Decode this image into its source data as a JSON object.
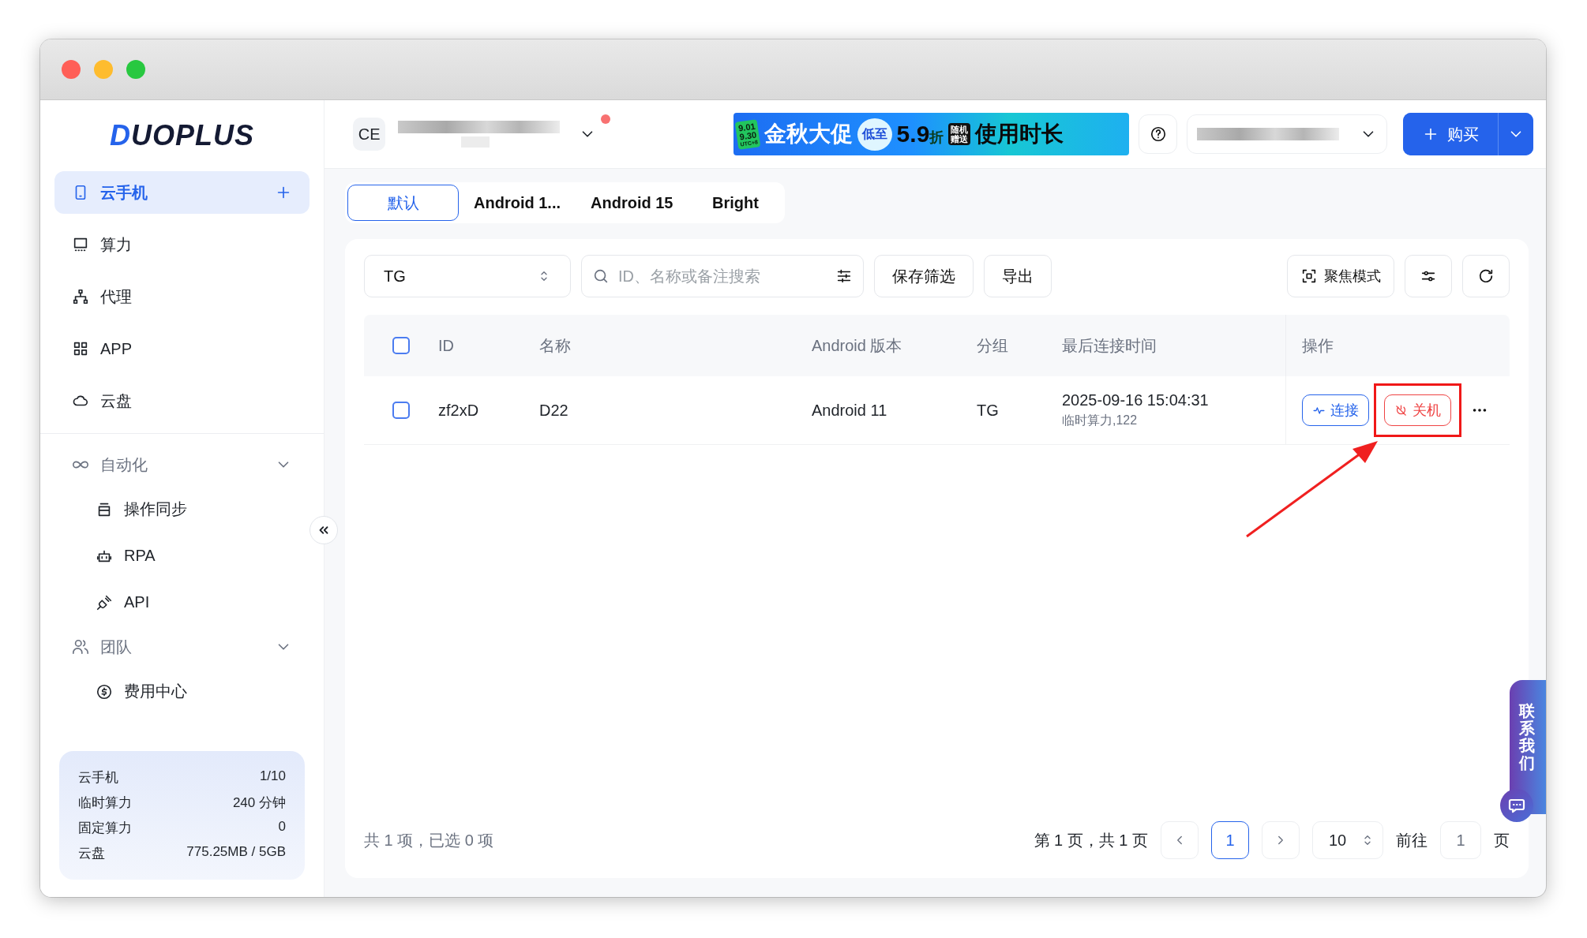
{
  "window": {
    "traffic_lights": [
      {
        "color": "#ff5f57"
      },
      {
        "color": "#febc2e"
      },
      {
        "color": "#28c840"
      }
    ]
  },
  "logo": {
    "mark": "D",
    "text": "UOPLUS"
  },
  "sidebar": {
    "nav": [
      {
        "label": "云手机",
        "selected": true
      },
      {
        "label": "算力",
        "selected": false
      },
      {
        "label": "代理",
        "selected": false
      },
      {
        "label": "APP",
        "selected": false
      },
      {
        "label": "云盘",
        "selected": false
      }
    ],
    "groups": [
      {
        "label": "自动化",
        "expanded": true,
        "children": [
          {
            "label": "操作同步",
            "selected": false
          },
          {
            "label": "RPA",
            "selected": false
          },
          {
            "label": "API",
            "selected": false
          }
        ]
      },
      {
        "label": "团队",
        "expanded": true,
        "children": [
          {
            "label": "费用中心",
            "selected": false
          }
        ]
      }
    ],
    "usage": [
      {
        "label": "云手机",
        "value": "1/10"
      },
      {
        "label": "临时算力",
        "value": "240 分钟"
      },
      {
        "label": "固定算力",
        "value": "0"
      },
      {
        "label": "云盘",
        "value": "775.25MB / 5GB"
      }
    ]
  },
  "top_bar": {
    "workspace": "CE",
    "notification": true,
    "promo_banner": {
      "date_badge": [
        "9.01",
        "9.30",
        "UTC+8"
      ],
      "headline": "金秋大促",
      "discount_prefix": "低至",
      "discount": "5.9",
      "discount_unit": "折",
      "gift_tag": [
        "随机",
        "赠送"
      ],
      "tagline": "使用时长"
    },
    "buy_button": "购买"
  },
  "tabs": [
    {
      "label": "默认",
      "selected": true
    },
    {
      "label": "Android 1...",
      "selected": false
    },
    {
      "label": "Android 15",
      "selected": false
    },
    {
      "label": "Bright",
      "selected": false
    }
  ],
  "toolbar": {
    "group_select": "TG",
    "search": {
      "placeholder": "ID、名称或备注搜索"
    },
    "buttons": [
      "保存筛选",
      "导出"
    ],
    "focus_mode": "聚焦模式"
  },
  "table": {
    "header_checked": false,
    "columns": [
      "ID",
      "名称",
      "Android 版本",
      "分组",
      "最后连接时间",
      "操作"
    ],
    "rows": [
      {
        "checked": false,
        "id": "zf2xD",
        "name": "D22",
        "android": "Android 11",
        "group": "TG",
        "last_connected": "2025-09-16 15:04:31",
        "compute": "临时算力,122",
        "actions": [
          "连接",
          "关机"
        ]
      }
    ]
  },
  "footer": {
    "summary": "共 1 项，已选 0 项",
    "page_info": "第 1 页，共 1 页",
    "pages": [
      {
        "label": "1",
        "selected": true
      }
    ],
    "page_size": "10",
    "goto_label": "前往",
    "goto_value": "1",
    "goto_suffix": "页"
  },
  "contact_tab": "联系我们"
}
